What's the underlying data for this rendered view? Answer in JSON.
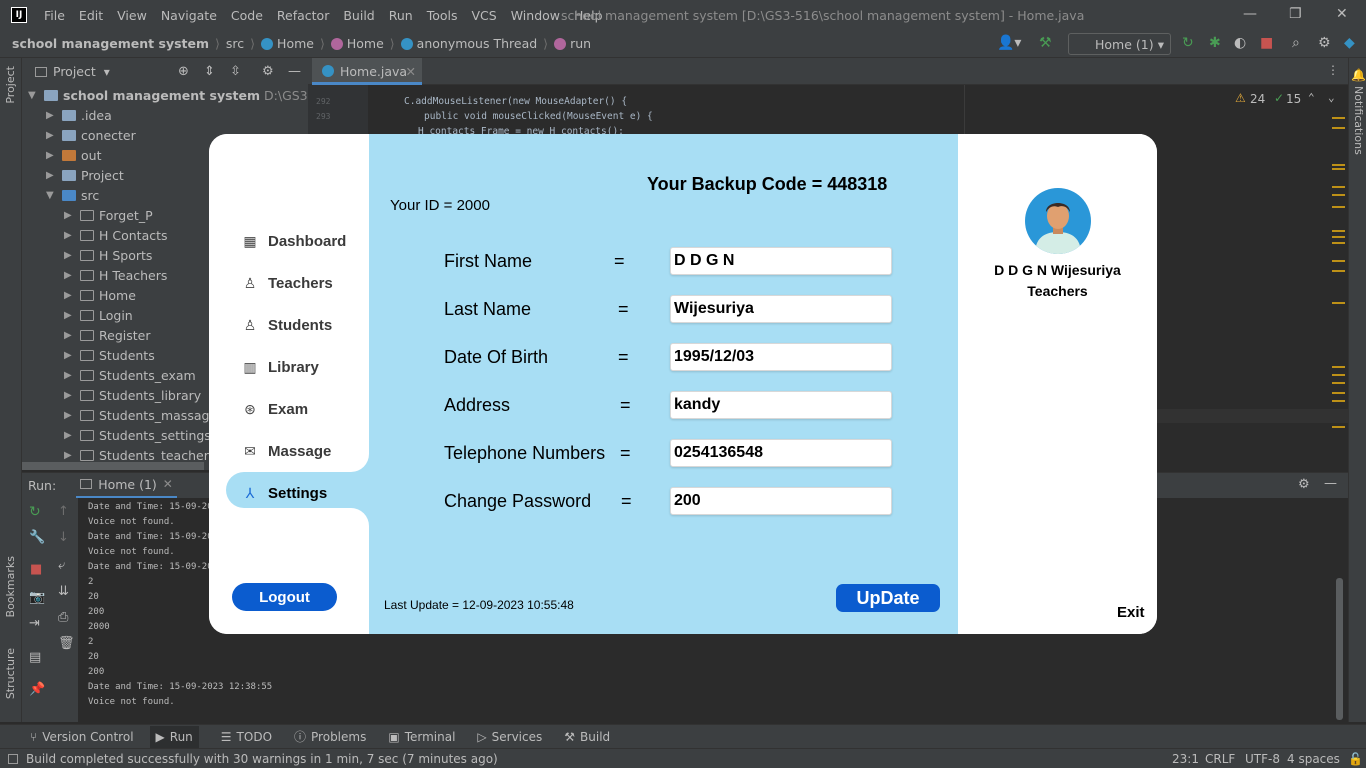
{
  "ide": {
    "logo": "IJ",
    "menu": [
      "File",
      "Edit",
      "View",
      "Navigate",
      "Code",
      "Refactor",
      "Build",
      "Run",
      "Tools",
      "VCS",
      "Window",
      "Help"
    ],
    "window_title": "school management system [D:\\GS3-516\\school management system] - Home.java",
    "breadcrumbs": [
      "school management system",
      "src",
      "Home",
      "Home",
      "anonymous Thread",
      "run"
    ],
    "run_config": "Home (1)",
    "left_strip": {
      "project": "Project",
      "bookmarks": "Bookmarks",
      "structure": "Structure"
    },
    "right_strip": {
      "notifications": "Notifications"
    },
    "project_panel": {
      "title": "Project",
      "root": "school management system",
      "root_path": "D:\\GS3-516\\scho",
      "items": [
        ".idea",
        "conecter",
        "out",
        "Project",
        "src",
        "Forget_P",
        "H Contacts",
        "H Sports",
        "H Teachers",
        "Home",
        "Login",
        "Register",
        "Students",
        "Students_exam",
        "Students_library",
        "Students_massage",
        "Students_settings",
        "Students_teacher"
      ]
    },
    "editor": {
      "tab": "Home.java",
      "line_numbers": [
        "292",
        "293"
      ],
      "code": [
        "C.addMouseListener(new MouseAdapter() {",
        "public void mouseClicked(MouseEvent e) {",
        "H_contacts Frame = new H_contacts();"
      ],
      "warnings": "24",
      "weak_warnings": "15"
    },
    "run_panel": {
      "label": "Run:",
      "tab": "Home (1)",
      "console": [
        "Date and Time: 15-09-2023",
        "Voice not found.",
        "Date and Time: 15-09-2023",
        "Voice not found.",
        "Date and Time: 15-09-2023",
        "2",
        "20",
        "200",
        "2000",
        "2",
        "20",
        "200",
        "Date and Time: 15-09-2023 12:38:55",
        "Voice not found."
      ]
    },
    "bottom_tabs": [
      "Version Control",
      "Run",
      "TODO",
      "Problems",
      "Terminal",
      "Services",
      "Build"
    ],
    "status": {
      "message": "Build completed successfully with 30 warnings in 1 min, 7 sec (7 minutes ago)",
      "position": "23:1",
      "line_sep": "CRLF",
      "encoding": "UTF-8",
      "indent": "4 spaces"
    }
  },
  "app": {
    "sidebar": {
      "items": [
        {
          "label": "Dashboard",
          "icon": "dashboard-icon"
        },
        {
          "label": "Teachers",
          "icon": "teacher-icon"
        },
        {
          "label": "Students",
          "icon": "student-icon"
        },
        {
          "label": "Library",
          "icon": "library-icon"
        },
        {
          "label": "Exam",
          "icon": "exam-icon"
        },
        {
          "label": "Massage",
          "icon": "mail-icon"
        },
        {
          "label": "Settings",
          "icon": "settings-icon"
        }
      ],
      "active": "Settings",
      "logout": "Logout"
    },
    "header": {
      "backup_code": "Your Backup Code  = 448318",
      "your_id": "Your ID  = 2000"
    },
    "form": [
      {
        "label": "First Name",
        "value": "D D G N"
      },
      {
        "label": "Last Name",
        "value": "Wijesuriya"
      },
      {
        "label": "Date Of Birth",
        "value": "1995/12/03"
      },
      {
        "label": "Address",
        "value": "kandy"
      },
      {
        "label": "Telephone Numbers",
        "value": "0254136548"
      },
      {
        "label": "Change Password",
        "value": "200"
      }
    ],
    "equals": "=",
    "last_update": "Last Update  =  12-09-2023 10:55:48",
    "update_button": "UpDate",
    "profile": {
      "name": "D D G N Wijesuriya",
      "role": "Teachers"
    },
    "exit": "Exit",
    "colors": {
      "accent": "#0b5ccf",
      "panel": "#a8def4"
    }
  }
}
